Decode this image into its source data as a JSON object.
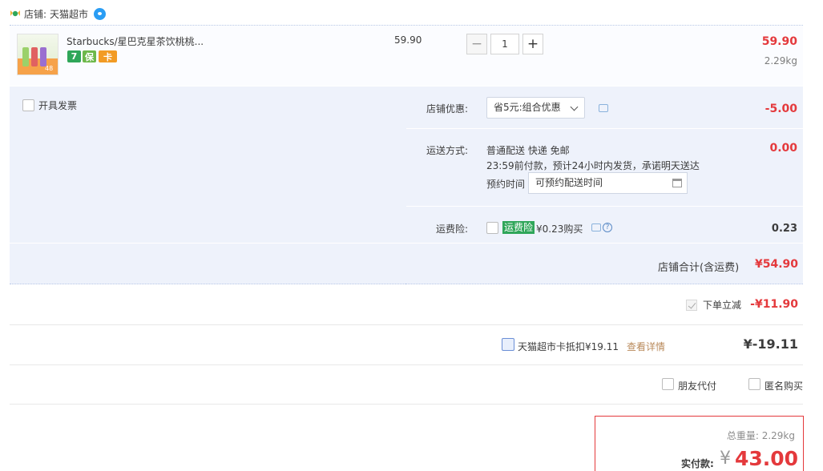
{
  "shop": {
    "prefix": "店铺:",
    "name": "天猫超市"
  },
  "item": {
    "title": "Starbucks/星巴克星茶饮桃桃...",
    "thumb_tag": "48",
    "service_badges": [
      {
        "name": "seven-day-return-icon",
        "text": "7",
        "color": "#2fa659"
      },
      {
        "name": "shield-icon",
        "text": "保",
        "color": "#6db84a"
      },
      {
        "name": "card-icon",
        "text": "卡",
        "color": "#f29b25"
      }
    ],
    "unit_price": "59.90",
    "quantity": "1",
    "subtotal": "59.90",
    "weight": "2.29kg"
  },
  "invoice": {
    "label": "开具发票"
  },
  "shop_discount": {
    "label": "店铺优惠:",
    "selected": "省5元:组合优惠",
    "amount": "-5.00"
  },
  "shipping": {
    "label": "运送方式:",
    "method": "普通配送 快递 免邮",
    "note": "23:59前付款，预计24小时内发货，承诺明天送达",
    "schedule_label": "预约时间",
    "schedule_placeholder": "可预约配送时间",
    "amount": "0.00"
  },
  "insurance": {
    "label": "运费险:",
    "badge": "运费险",
    "text": "¥0.23购买",
    "amount": "0.23"
  },
  "shop_total": {
    "label": "店铺合计(含运费)",
    "amount": "¥54.90"
  },
  "instant_discount": {
    "label": "下单立减",
    "amount": "-¥11.90"
  },
  "card_deduct": {
    "label": "天猫超市卡抵扣¥19.11",
    "link": "查看详情",
    "amount": "¥-19.11"
  },
  "options": {
    "friend_pay": "朋友代付",
    "anonymous": "匿名购买"
  },
  "final": {
    "weight_label": "总重量:",
    "weight": "2.29kg",
    "pay_label": "实付款:",
    "currency": "¥",
    "amount": "43.00"
  }
}
